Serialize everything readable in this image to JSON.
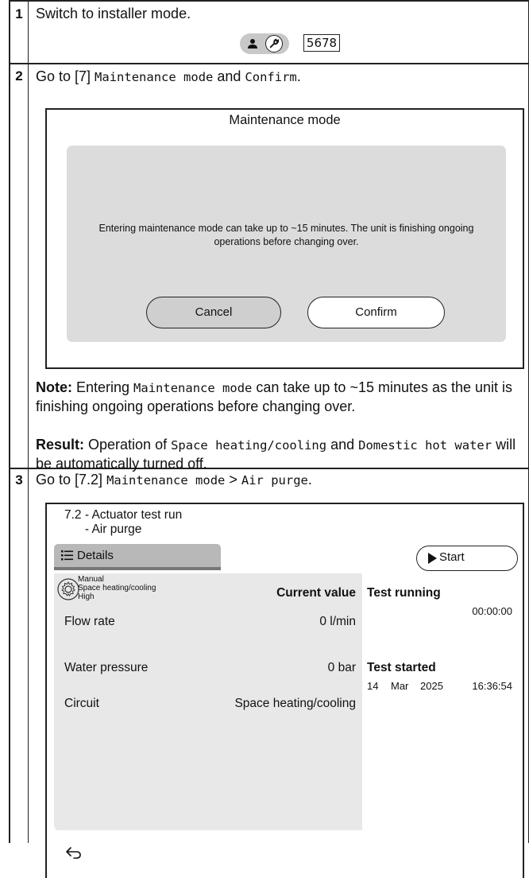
{
  "step1": {
    "number": "1",
    "text": "Switch to installer mode.",
    "icons": [
      "person-icon",
      "wrench-icon"
    ],
    "pin": "5678"
  },
  "step2": {
    "number": "2",
    "text_prefix": "Go to [7] ",
    "menu_item": "Maintenance mode",
    "text_mid": " and ",
    "action": "Confirm",
    "text_suffix": ".",
    "screen": {
      "title": "Maintenance mode",
      "message": "Entering maintenance mode can take up to ~15 minutes. The unit is finishing ongoing operations before changing over.",
      "cancel_label": "Cancel",
      "confirm_label": "Confirm"
    },
    "note_label": "Note:",
    "note_text1": " Entering ",
    "note_code": "Maintenance mode",
    "note_text2": " can take up to ~15 minutes as the unit is finishing ongoing operations before changing over.",
    "result_label": "Result:",
    "result_text1": " Operation of ",
    "result_code1": "Space heating/cooling",
    "result_text2": " and ",
    "result_code2": "Domestic hot water",
    "result_text3": " will be automatically turned off."
  },
  "step3": {
    "number": "3",
    "text_prefix": "Go to [7.2] ",
    "menu_item": "Maintenance mode",
    "sep": " > ",
    "sub_item": "Air purge",
    "text_suffix": ".",
    "screen": {
      "title_line1": "7.2 - Actuator test run",
      "title_line2": "      - Air purge",
      "details_label": "Details",
      "start_label": "Start",
      "mode_line1": "Manual",
      "mode_line2": "Space heating/cooling",
      "mode_line3": "High",
      "current_value_header": "Current value",
      "rows": [
        {
          "label": "Flow rate",
          "value": "0 l/min"
        },
        {
          "label": "Water pressure",
          "value": "0 bar"
        },
        {
          "label": "Circuit",
          "value": "Space heating/cooling"
        }
      ],
      "test_running_label": "Test running",
      "elapsed": "00:00:00",
      "test_started_label": "Test started",
      "started_day": "14",
      "started_month": "Mar",
      "started_year": "2025",
      "started_time": "16:36:54"
    }
  }
}
